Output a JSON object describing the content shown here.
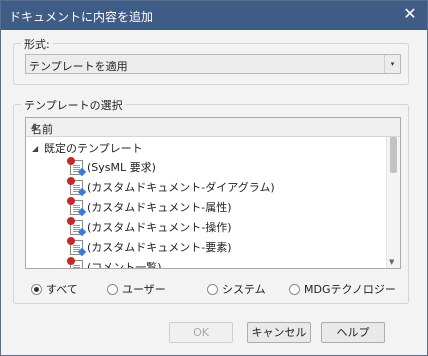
{
  "window": {
    "title": "ドキュメントに内容を追加",
    "close_glyph": "✕"
  },
  "format_group": {
    "label": "形式:",
    "combo_value": "テンプレートを適用",
    "combo_arrow": "▾"
  },
  "template_group": {
    "label": "テンプレートの選択",
    "column_header": "名前",
    "sort_glyph": "▲",
    "scroll_down_glyph": "▼",
    "root": {
      "expander": "◢",
      "label": "既定のテンプレート"
    },
    "items": [
      {
        "label": "(SysML 要求)",
        "icon": "document-template-icon"
      },
      {
        "label": "(カスタムドキュメント-ダイアグラム)",
        "icon": "document-template-icon"
      },
      {
        "label": "(カスタムドキュメント-属性)",
        "icon": "document-template-icon"
      },
      {
        "label": "(カスタムドキュメント-操作)",
        "icon": "document-template-icon"
      },
      {
        "label": "(カスタムドキュメント-要素)",
        "icon": "document-template-icon"
      },
      {
        "label": "(コメント一覧)",
        "icon": "document-template-icon"
      }
    ]
  },
  "filters": {
    "all": "すべて",
    "user": "ユーザー",
    "system": "システム",
    "mdg": "MDGテクノロジー",
    "selected": "all"
  },
  "buttons": {
    "ok": "OK",
    "cancel": "キャンセル",
    "help": "ヘルプ"
  },
  "colors": {
    "titlebar": "#3f5c86",
    "icon_badge": "#c62828"
  }
}
